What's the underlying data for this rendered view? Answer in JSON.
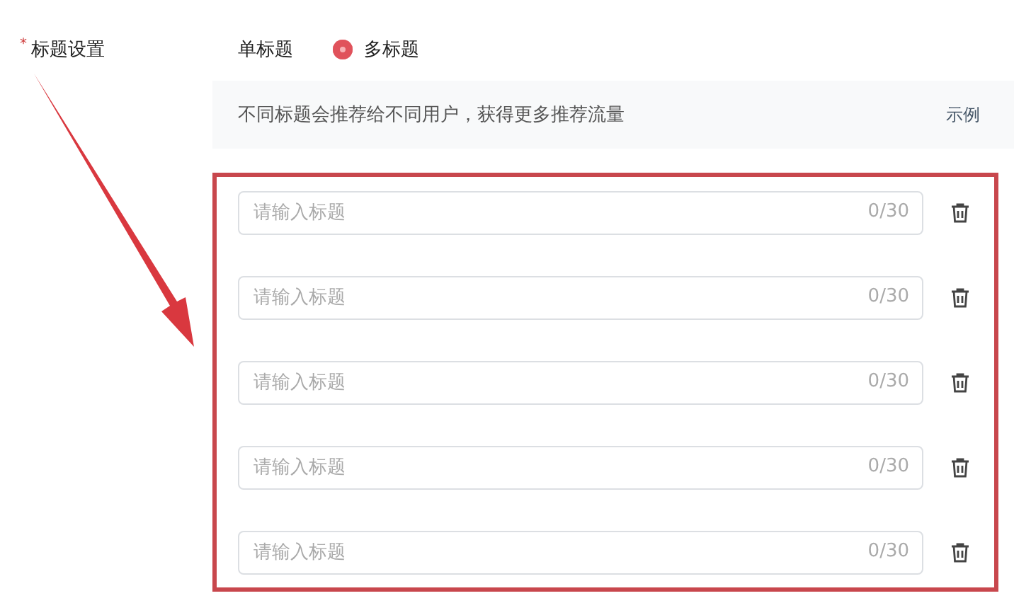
{
  "field": {
    "required_mark": "*",
    "label": "标题设置"
  },
  "options": [
    {
      "label": "单标题",
      "selected": false
    },
    {
      "label": "多标题",
      "selected": true
    }
  ],
  "hint": {
    "text": "不同标题会推荐给不同用户，获得更多推荐流量",
    "link": "示例"
  },
  "titles": [
    {
      "placeholder": "请输入标题",
      "counter": "0/30"
    },
    {
      "placeholder": "请输入标题",
      "counter": "0/30"
    },
    {
      "placeholder": "请输入标题",
      "counter": "0/30"
    },
    {
      "placeholder": "请输入标题",
      "counter": "0/30"
    },
    {
      "placeholder": "请输入标题",
      "counter": "0/30"
    }
  ]
}
